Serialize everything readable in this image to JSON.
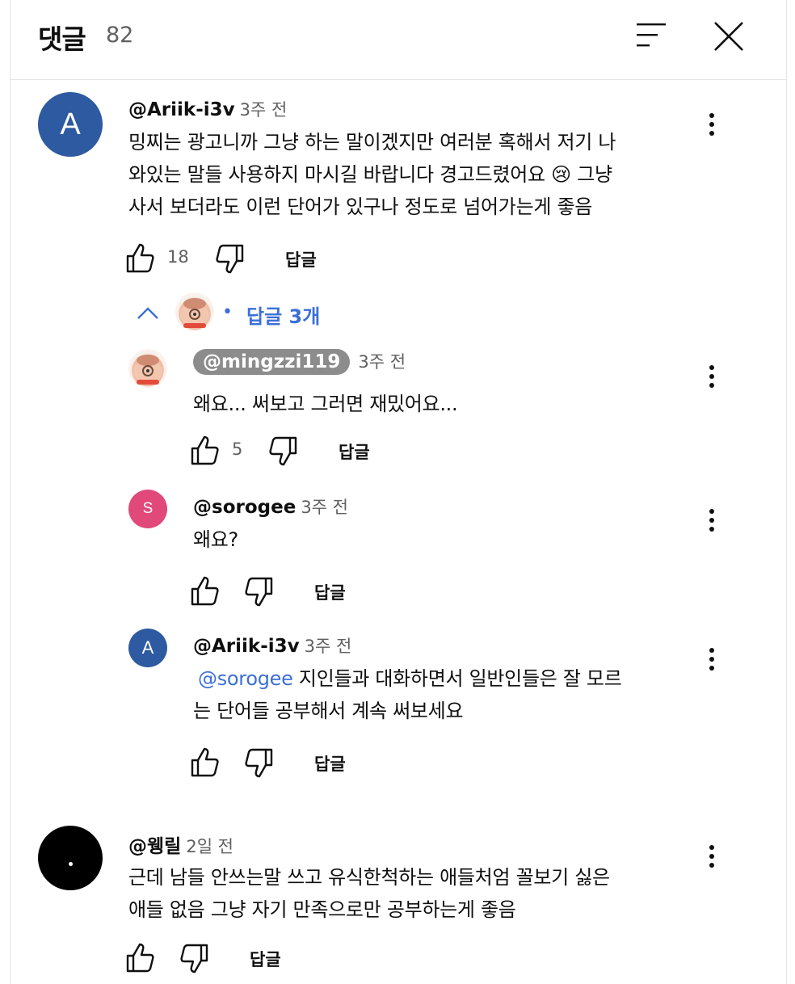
{
  "header": {
    "title": "댓글",
    "count": "82",
    "sort_icon": "sort-icon",
    "close_icon": "close-icon"
  },
  "comments": [
    {
      "author": "@Ariik-i3v",
      "time": "3주 전",
      "avatar_letter": "A",
      "avatar_color": "#2d5aa0",
      "lines": [
        "밍찌는 광고니까 그냥 하는 말이겠지만 여러분 혹해서 저기 나",
        "와있는 말들 사용하지 마시길 바랍니다 경고드렸어요 😢 그냥",
        "사서 보더라도 이런 단어가 있구나 정도로 넘어가는게 좋음"
      ],
      "likes": "18",
      "reply_label": "답글",
      "replies_toggle": "답글 3개"
    },
    {
      "author": "@mingzzi119",
      "time": "3주 전",
      "text": "왜요... 써보고 그러면 재밌어요...",
      "likes": "5",
      "reply_label": "답글"
    },
    {
      "author": "@sorogee",
      "time": "3주 전",
      "avatar_letter": "S",
      "avatar_color": "#e0497a",
      "text": "왜요?",
      "reply_label": "답글"
    },
    {
      "author": "@Ariik-i3v",
      "time": "3주 전",
      "avatar_letter": "A",
      "avatar_color": "#2d5aa0",
      "mention": "@sorogee",
      "line1": "지인들과 대화하면서 일반인들은 잘 모르",
      "line2": "는 단어들 공부해서 계속 써보세요",
      "reply_label": "답글"
    },
    {
      "author": "@웽릴",
      "time": "2일 전",
      "avatar_color": "#000000",
      "lines": [
        "근데 남들 안쓰는말 쓰고 유식한척하는 애들처엄 꼴보기 싫은",
        "애들 없음 그냥 자기 만족으로만 공부하는게 좋음"
      ],
      "reply_label": "답글"
    }
  ]
}
